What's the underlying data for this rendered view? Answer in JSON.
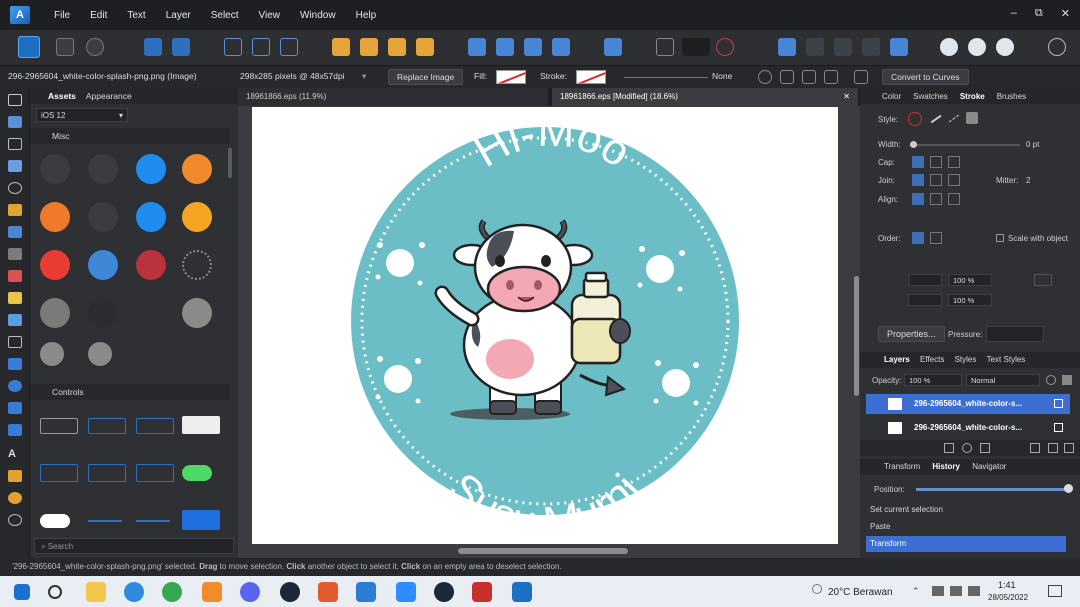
{
  "menu": {
    "items": [
      "File",
      "Edit",
      "Text",
      "Layer",
      "Select",
      "View",
      "Window",
      "Help"
    ]
  },
  "window_controls": {
    "minimize": "–",
    "restore": "⧉",
    "close": "✕"
  },
  "context": {
    "selection_name": "296-2965604_white-color-splash-png.png (Image)",
    "dimensions": "298x285 pixels @ 48x57dpi",
    "replace_image": "Replace Image",
    "fill_label": "Fill:",
    "stroke_label": "Stroke:",
    "stroke_value": "None",
    "convert_to_curves": "Convert to Curves"
  },
  "assets": {
    "tabs": [
      "Assets",
      "Appearance"
    ],
    "category": "iOS 12",
    "section_misc": "Misc",
    "section_controls": "Controls",
    "search_placeholder": "Search"
  },
  "doctabs": {
    "tab1": "18961866.eps (11.9%)",
    "tab2": "18961866.eps [Modified] (18.6%)"
  },
  "artwork": {
    "title_top": "Hi-Moo",
    "title_bottom": "Susu Murni",
    "colors": {
      "badge": "#6cbec6",
      "text": "#ffffff"
    }
  },
  "right": {
    "top_tabs": [
      "Color",
      "Swatches",
      "Stroke",
      "Brushes"
    ],
    "style_label": "Style:",
    "width_label": "Width:",
    "width_value": "0 pt",
    "cap_label": "Cap:",
    "join_label": "Join:",
    "mitter_label": "Mitter:",
    "mitter_value": "2",
    "align_label": "Align:",
    "order_label": "Order:",
    "scale_label": "Scale with object",
    "start_value": "100 %",
    "end_value": "100 %",
    "properties": "Properties...",
    "pressure": "Pressure:",
    "layer_tabs": [
      "Layers",
      "Effects",
      "Styles",
      "Text Styles"
    ],
    "opacity_label": "Opacity:",
    "opacity_value": "100 %",
    "blend_mode": "Normal",
    "layers": [
      "296-2965604_white-color-s...",
      "296-2965604_white-color-s..."
    ],
    "history_tabs": [
      "Transform",
      "History",
      "Navigator"
    ],
    "position_label": "Position:",
    "history": [
      "Set current selection",
      "Paste",
      "Transform"
    ]
  },
  "status": {
    "p1": "'296-2965604_white-color-splash-png.png' selected. ",
    "b1": "Drag",
    "p2": " to move selection. ",
    "b2": "Click",
    "p3": " another object to select it. ",
    "b3": "Click",
    "p4": " on an empty area to deselect selection."
  },
  "taskbar": {
    "weather": "20°C  Berawan",
    "time": "1:41",
    "date": "28/05/2022"
  }
}
